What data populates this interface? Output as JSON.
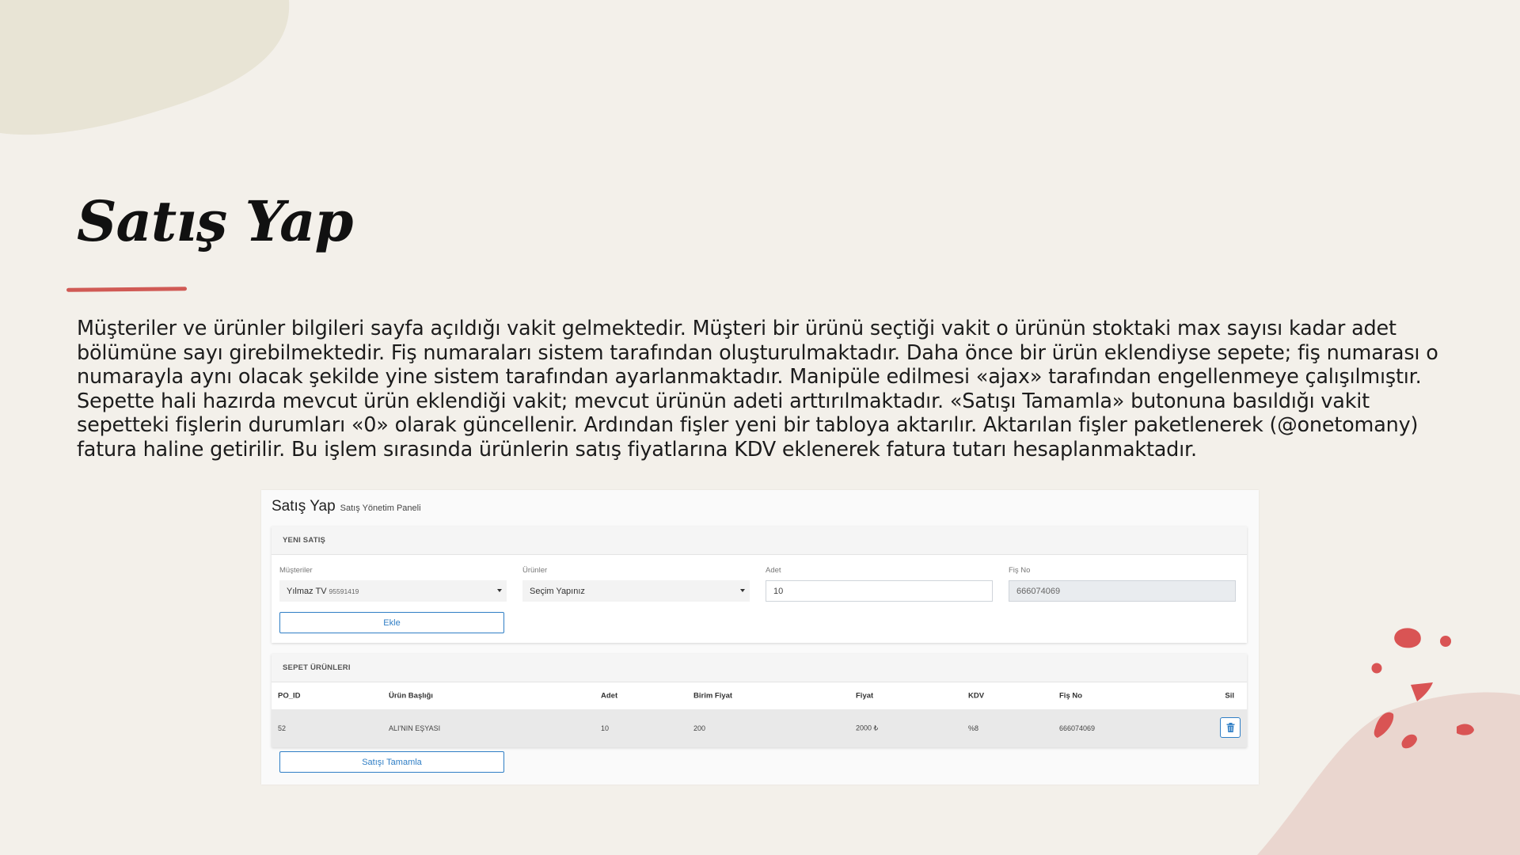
{
  "colors": {
    "background": "#f3f0ea",
    "accent_red": "#d05a55",
    "button_blue": "#2f7ec5",
    "blob_beige": "#e8e4d5",
    "corner_pink": "#ead6cf"
  },
  "slide": {
    "title": "Satış Yap",
    "paragraph": "Müşteriler ve ürünler bilgileri sayfa açıldığı vakit gelmektedir. Müşteri bir ürünü seçtiği vakit o ürünün stoktaki max sayısı kadar adet bölümüne sayı girebilmektedir. Fiş numaraları sistem tarafından oluşturulmaktadır. Daha önce bir ürün eklendiyse sepete; fiş numarası o numarayla aynı olacak şekilde yine sistem tarafından ayarlanmaktadır. Manipüle edilmesi «ajax» tarafından engellenmeye çalışılmıştır. Sepette hali hazırda mevcut ürün eklendiği vakit; mevcut ürünün adeti arttırılmaktadır. «Satışı Tamamla» butonuna basıldığı vakit sepetteki fişlerin durumları «0» olarak güncellenir. Ardından fişler yeni bir tabloya aktarılır. Aktarılan fişler paketlenerek (@onetomany) fatura haline getirilir. Bu işlem sırasında ürünlerin satış fiyatlarına KDV eklenerek fatura tutarı hesaplanmaktadır."
  },
  "screenshot": {
    "title": "Satış Yap",
    "subtitle": "Satış Yönetim Paneli",
    "new_sale": {
      "heading": "YENI SATIŞ",
      "customers": {
        "label": "Müşteriler",
        "value": "Yılmaz TV",
        "sub": "95591419"
      },
      "products": {
        "label": "Ürünler",
        "value": "Seçim Yapınız"
      },
      "quantity": {
        "label": "Adet",
        "value": "10"
      },
      "receipt": {
        "label": "Fiş No",
        "value": "666074069"
      },
      "add_button": "Ekle"
    },
    "cart": {
      "heading": "SEPET ÜRÜNLERI",
      "columns": [
        "PO_ID",
        "Ürün Başlığı",
        "Adet",
        "Birim Fiyat",
        "Fiyat",
        "KDV",
        "Fiş No",
        "Sil"
      ],
      "rows": [
        {
          "po_id": "52",
          "title": "ALI'NIN EŞYASI",
          "qty": "10",
          "unit_price": "200",
          "price": "2000 ₺",
          "kdv": "%8",
          "receipt": "666074069"
        }
      ],
      "delete_icon": "trash-icon"
    },
    "complete_button": "Satışı Tamamla"
  }
}
